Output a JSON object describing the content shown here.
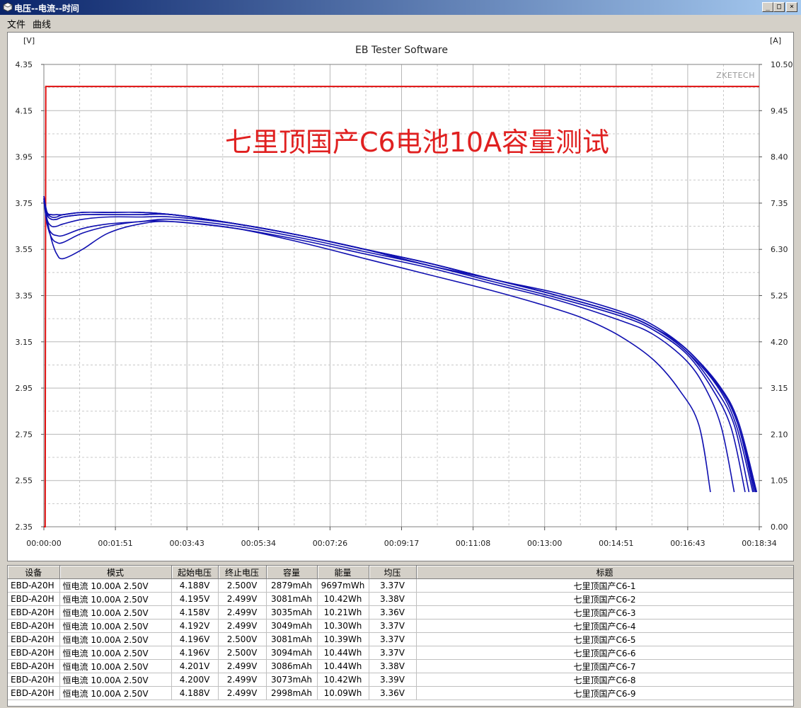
{
  "window": {
    "title": "电压--电流--时间",
    "buttons": [
      "_",
      "□",
      "×"
    ]
  },
  "menu": [
    "文件",
    "曲线"
  ],
  "chart_data": {
    "type": "line",
    "title": "EB Tester Software",
    "watermark": "ZKETECH",
    "annotation": "七里顶国产C6电池10A容量测试",
    "y_left_unit": "[V]",
    "y_right_unit": "[A]",
    "y_left_range": [
      2.35,
      4.35
    ],
    "y_left_ticks": [
      "4.35",
      "4.15",
      "3.95",
      "3.75",
      "3.55",
      "3.35",
      "3.15",
      "2.95",
      "2.75",
      "2.55",
      "2.35"
    ],
    "y_right_range": [
      0,
      10.5
    ],
    "y_right_ticks": [
      "10.50",
      "9.45",
      "8.40",
      "7.35",
      "6.30",
      "5.25",
      "4.20",
      "3.15",
      "2.10",
      "1.05",
      "0.00"
    ],
    "x_range_seconds": [
      0,
      1114
    ],
    "x_ticks": [
      "00:00:00",
      "00:01:51",
      "00:03:43",
      "00:05:34",
      "00:07:26",
      "00:09:17",
      "00:11:08",
      "00:13:00",
      "00:14:51",
      "00:16:43",
      "00:18:34"
    ],
    "grid": true,
    "current_series": {
      "name": "电流",
      "color": "#e01010",
      "x": [
        0,
        2,
        3,
        1114
      ],
      "y": [
        0,
        0,
        10.0,
        10.0
      ]
    },
    "voltage_color": "#1010b0",
    "series": [
      {
        "name": "七里顶国产C6-1",
        "x": [
          0,
          5,
          12,
          20,
          30,
          60,
          100,
          150,
          200,
          300,
          400,
          500,
          600,
          700,
          800,
          850,
          900,
          950,
          990,
          1020,
          1038
        ],
        "y": [
          3.76,
          3.68,
          3.59,
          3.53,
          3.51,
          3.55,
          3.62,
          3.66,
          3.67,
          3.64,
          3.58,
          3.51,
          3.44,
          3.37,
          3.29,
          3.24,
          3.17,
          3.07,
          2.94,
          2.79,
          2.5
        ]
      },
      {
        "name": "七里顶国产C6-2",
        "x": [
          0,
          5,
          12,
          20,
          30,
          60,
          100,
          150,
          200,
          300,
          400,
          500,
          600,
          700,
          800,
          900,
          950,
          1000,
          1050,
          1080,
          1108
        ],
        "y": [
          3.78,
          3.71,
          3.69,
          3.69,
          3.7,
          3.71,
          3.71,
          3.71,
          3.7,
          3.66,
          3.61,
          3.55,
          3.48,
          3.42,
          3.35,
          3.27,
          3.21,
          3.12,
          2.96,
          2.8,
          2.5
        ]
      },
      {
        "name": "七里顶国产C6-3",
        "x": [
          0,
          5,
          12,
          20,
          30,
          60,
          100,
          150,
          200,
          300,
          400,
          500,
          600,
          700,
          800,
          900,
          950,
          1000,
          1040,
          1070,
          1092
        ],
        "y": [
          3.77,
          3.66,
          3.62,
          3.61,
          3.61,
          3.64,
          3.66,
          3.67,
          3.68,
          3.65,
          3.6,
          3.54,
          3.48,
          3.41,
          3.34,
          3.26,
          3.2,
          3.1,
          2.95,
          2.78,
          2.5
        ]
      },
      {
        "name": "七里顶国产C6-4",
        "x": [
          0,
          5,
          12,
          20,
          30,
          60,
          100,
          150,
          200,
          300,
          400,
          500,
          600,
          700,
          800,
          900,
          950,
          1000,
          1045,
          1075,
          1098
        ],
        "y": [
          3.77,
          3.68,
          3.65,
          3.65,
          3.66,
          3.68,
          3.69,
          3.69,
          3.69,
          3.66,
          3.61,
          3.55,
          3.48,
          3.42,
          3.35,
          3.27,
          3.21,
          3.11,
          2.95,
          2.79,
          2.5
        ]
      },
      {
        "name": "七里顶国产C6-5",
        "x": [
          0,
          5,
          12,
          20,
          30,
          60,
          100,
          150,
          200,
          300,
          400,
          500,
          600,
          700,
          800,
          900,
          950,
          1000,
          1050,
          1080,
          1106
        ],
        "y": [
          3.77,
          3.7,
          3.68,
          3.68,
          3.69,
          3.7,
          3.7,
          3.7,
          3.7,
          3.66,
          3.61,
          3.55,
          3.49,
          3.42,
          3.35,
          3.27,
          3.21,
          3.12,
          2.96,
          2.8,
          2.5
        ]
      },
      {
        "name": "七里顶国产C6-6",
        "x": [
          0,
          5,
          12,
          20,
          30,
          60,
          100,
          150,
          200,
          300,
          400,
          500,
          600,
          700,
          800,
          900,
          950,
          1000,
          1052,
          1082,
          1110
        ],
        "y": [
          3.77,
          3.71,
          3.7,
          3.7,
          3.7,
          3.71,
          3.71,
          3.71,
          3.7,
          3.66,
          3.61,
          3.55,
          3.49,
          3.42,
          3.36,
          3.28,
          3.22,
          3.12,
          2.96,
          2.8,
          2.5
        ]
      },
      {
        "name": "七里顶国产C6-7",
        "x": [
          0,
          5,
          12,
          20,
          30,
          60,
          100,
          150,
          200,
          300,
          400,
          500,
          600,
          700,
          800,
          900,
          950,
          1000,
          1050,
          1080,
          1109
        ],
        "y": [
          3.78,
          3.71,
          3.7,
          3.7,
          3.7,
          3.71,
          3.71,
          3.71,
          3.7,
          3.66,
          3.61,
          3.55,
          3.49,
          3.42,
          3.35,
          3.27,
          3.21,
          3.12,
          2.96,
          2.8,
          2.5
        ]
      },
      {
        "name": "七里顶国产C6-8",
        "x": [
          0,
          5,
          12,
          20,
          30,
          60,
          100,
          150,
          200,
          300,
          400,
          500,
          600,
          700,
          800,
          900,
          950,
          1000,
          1048,
          1078,
          1104
        ],
        "y": [
          3.77,
          3.7,
          3.68,
          3.68,
          3.69,
          3.7,
          3.7,
          3.7,
          3.7,
          3.66,
          3.61,
          3.55,
          3.48,
          3.42,
          3.35,
          3.27,
          3.21,
          3.11,
          2.96,
          2.79,
          2.5
        ]
      },
      {
        "name": "七里顶国产C6-9",
        "x": [
          0,
          5,
          12,
          20,
          30,
          60,
          100,
          150,
          200,
          300,
          400,
          500,
          600,
          700,
          800,
          900,
          950,
          1000,
          1030,
          1055,
          1075
        ],
        "y": [
          3.76,
          3.66,
          3.6,
          3.58,
          3.58,
          3.62,
          3.65,
          3.67,
          3.67,
          3.64,
          3.59,
          3.53,
          3.47,
          3.4,
          3.33,
          3.24,
          3.18,
          3.07,
          2.95,
          2.78,
          2.5
        ]
      }
    ]
  },
  "table": {
    "columns": [
      "设备",
      "模式",
      "起始电压",
      "终止电压",
      "容量",
      "能量",
      "均压",
      "标题"
    ],
    "rows": [
      {
        "device": "EBD-A20H",
        "mode": "恒电流 10.00A 2.50V",
        "start_v": "4.188V",
        "end_v": "2.500V",
        "capacity": "2879mAh",
        "energy": "9697mWh",
        "avg_v": "3.37V",
        "title": "七里顶国产C6-1"
      },
      {
        "device": "EBD-A20H",
        "mode": "恒电流 10.00A 2.50V",
        "start_v": "4.195V",
        "end_v": "2.499V",
        "capacity": "3081mAh",
        "energy": "10.42Wh",
        "avg_v": "3.38V",
        "title": "七里顶国产C6-2"
      },
      {
        "device": "EBD-A20H",
        "mode": "恒电流 10.00A 2.50V",
        "start_v": "4.158V",
        "end_v": "2.499V",
        "capacity": "3035mAh",
        "energy": "10.21Wh",
        "avg_v": "3.36V",
        "title": "七里顶国产C6-3"
      },
      {
        "device": "EBD-A20H",
        "mode": "恒电流 10.00A 2.50V",
        "start_v": "4.192V",
        "end_v": "2.499V",
        "capacity": "3049mAh",
        "energy": "10.30Wh",
        "avg_v": "3.37V",
        "title": "七里顶国产C6-4"
      },
      {
        "device": "EBD-A20H",
        "mode": "恒电流 10.00A 2.50V",
        "start_v": "4.196V",
        "end_v": "2.500V",
        "capacity": "3081mAh",
        "energy": "10.39Wh",
        "avg_v": "3.37V",
        "title": "七里顶国产C6-5"
      },
      {
        "device": "EBD-A20H",
        "mode": "恒电流 10.00A 2.50V",
        "start_v": "4.196V",
        "end_v": "2.500V",
        "capacity": "3094mAh",
        "energy": "10.44Wh",
        "avg_v": "3.37V",
        "title": "七里顶国产C6-6"
      },
      {
        "device": "EBD-A20H",
        "mode": "恒电流 10.00A 2.50V",
        "start_v": "4.201V",
        "end_v": "2.499V",
        "capacity": "3086mAh",
        "energy": "10.44Wh",
        "avg_v": "3.38V",
        "title": "七里顶国产C6-7"
      },
      {
        "device": "EBD-A20H",
        "mode": "恒电流 10.00A 2.50V",
        "start_v": "4.200V",
        "end_v": "2.499V",
        "capacity": "3073mAh",
        "energy": "10.42Wh",
        "avg_v": "3.39V",
        "title": "七里顶国产C6-8"
      },
      {
        "device": "EBD-A20H",
        "mode": "恒电流 10.00A 2.50V",
        "start_v": "4.188V",
        "end_v": "2.499V",
        "capacity": "2998mAh",
        "energy": "10.09Wh",
        "avg_v": "3.36V",
        "title": "七里顶国产C6-9"
      }
    ]
  }
}
